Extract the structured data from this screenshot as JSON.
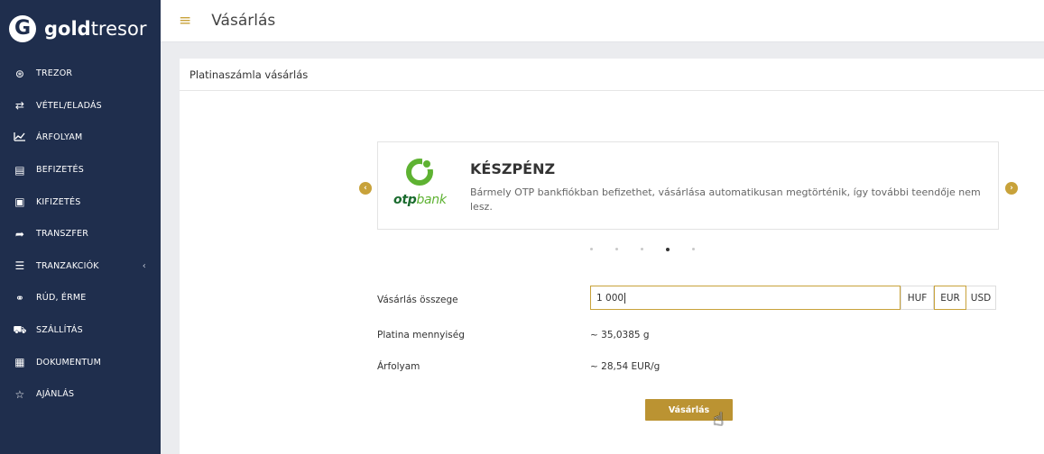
{
  "brand": {
    "mark": "G",
    "name_bold": "gold",
    "name_light": "tresor"
  },
  "sidebar": {
    "items": [
      {
        "label": "TREZOR",
        "icon": "asterisk-icon",
        "glyph": "⊛"
      },
      {
        "label": "VÉTEL/ELADÁS",
        "icon": "exchange-icon",
        "glyph": "⇄"
      },
      {
        "label": "ÁRFOLYAM",
        "icon": "line-chart-icon",
        "glyph": "📈"
      },
      {
        "label": "BEFIZETÉS",
        "icon": "credit-card-icon",
        "glyph": "▤"
      },
      {
        "label": "KIFIZETÉS",
        "icon": "banknote-icon",
        "glyph": "▣"
      },
      {
        "label": "TRANSZFER",
        "icon": "share-arrow-icon",
        "glyph": "➦"
      },
      {
        "label": "TRANZAKCIÓK",
        "icon": "list-icon",
        "glyph": "☰",
        "caret": "‹"
      },
      {
        "label": "RÚD, ÉRME",
        "icon": "coins-icon",
        "glyph": "⚭"
      },
      {
        "label": "SZÁLLÍTÁS",
        "icon": "truck-icon",
        "glyph": "⛟"
      },
      {
        "label": "DOKUMENTUM",
        "icon": "document-icon",
        "glyph": "▦"
      },
      {
        "label": "AJÁNLÁS",
        "icon": "star-icon",
        "glyph": "☆"
      }
    ]
  },
  "header": {
    "title": "Vásárlás",
    "menu_glyph": "≡"
  },
  "panel": {
    "title": "Platinaszámla vásárlás"
  },
  "carousel": {
    "card": {
      "logo_bold": "otp",
      "logo_light": "bank",
      "title": "KÉSZPÉNZ",
      "description": "Bármely OTP bankfiókban befizethet, vásárlása automatikusan megtörténik, így további teendője nem lesz."
    },
    "prev_glyph": "‹",
    "next_glyph": "›",
    "dots_total": 5,
    "active_dot_index": 3
  },
  "form": {
    "amount_label": "Vásárlás összege",
    "amount_value": "1 000",
    "currencies": [
      "HUF",
      "EUR",
      "USD"
    ],
    "selected_currency": "EUR",
    "quantity_label": "Platina mennyiség",
    "quantity_value": "~ 35,0385  g",
    "rate_label": "Árfolyam",
    "rate_value": "~ 28,54  EUR/g",
    "buy_label": "Vásárlás"
  }
}
